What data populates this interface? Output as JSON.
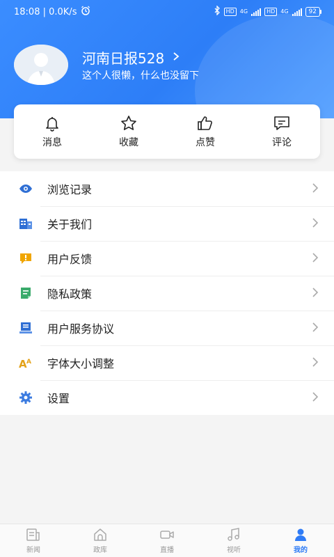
{
  "status_bar": {
    "time_speed": "18:08 | 0.0K/s",
    "net_type_1": "4G",
    "net_type_2": "4G",
    "hd_1": "HD",
    "hd_2": "HD",
    "battery": "92"
  },
  "profile": {
    "name": "河南日报528",
    "bio": "这个人很懒，什么也没留下"
  },
  "quick_actions": [
    {
      "label": "消息",
      "icon": "bell-icon"
    },
    {
      "label": "收藏",
      "icon": "star-icon"
    },
    {
      "label": "点赞",
      "icon": "thumbs-up-icon"
    },
    {
      "label": "评论",
      "icon": "comment-icon"
    }
  ],
  "menu": [
    {
      "label": "浏览记录",
      "icon": "eye-icon",
      "color": "#2f6fd4"
    },
    {
      "label": "关于我们",
      "icon": "building-icon",
      "color": "#2f6fd4"
    },
    {
      "label": "用户反馈",
      "icon": "feedback-icon",
      "color": "#f0a500"
    },
    {
      "label": "隐私政策",
      "icon": "document-icon",
      "color": "#3aaa6b"
    },
    {
      "label": "用户服务协议",
      "icon": "agreement-icon",
      "color": "#2f6fd4"
    },
    {
      "label": "字体大小调整",
      "icon": "font-size-icon",
      "color": "#e3a21a"
    },
    {
      "label": "设置",
      "icon": "gear-icon",
      "color": "#3b7be0"
    }
  ],
  "tabs": [
    {
      "label": "新闻",
      "icon": "news-icon",
      "active": false
    },
    {
      "label": "政库",
      "icon": "home-icon",
      "active": false
    },
    {
      "label": "直播",
      "icon": "video-camera-icon",
      "active": false
    },
    {
      "label": "视听",
      "icon": "music-icon",
      "active": false
    },
    {
      "label": "我的",
      "icon": "user-icon",
      "active": true
    }
  ],
  "colors": {
    "header_blue": "#2d7ef7",
    "accent": "#2f7cf6"
  }
}
